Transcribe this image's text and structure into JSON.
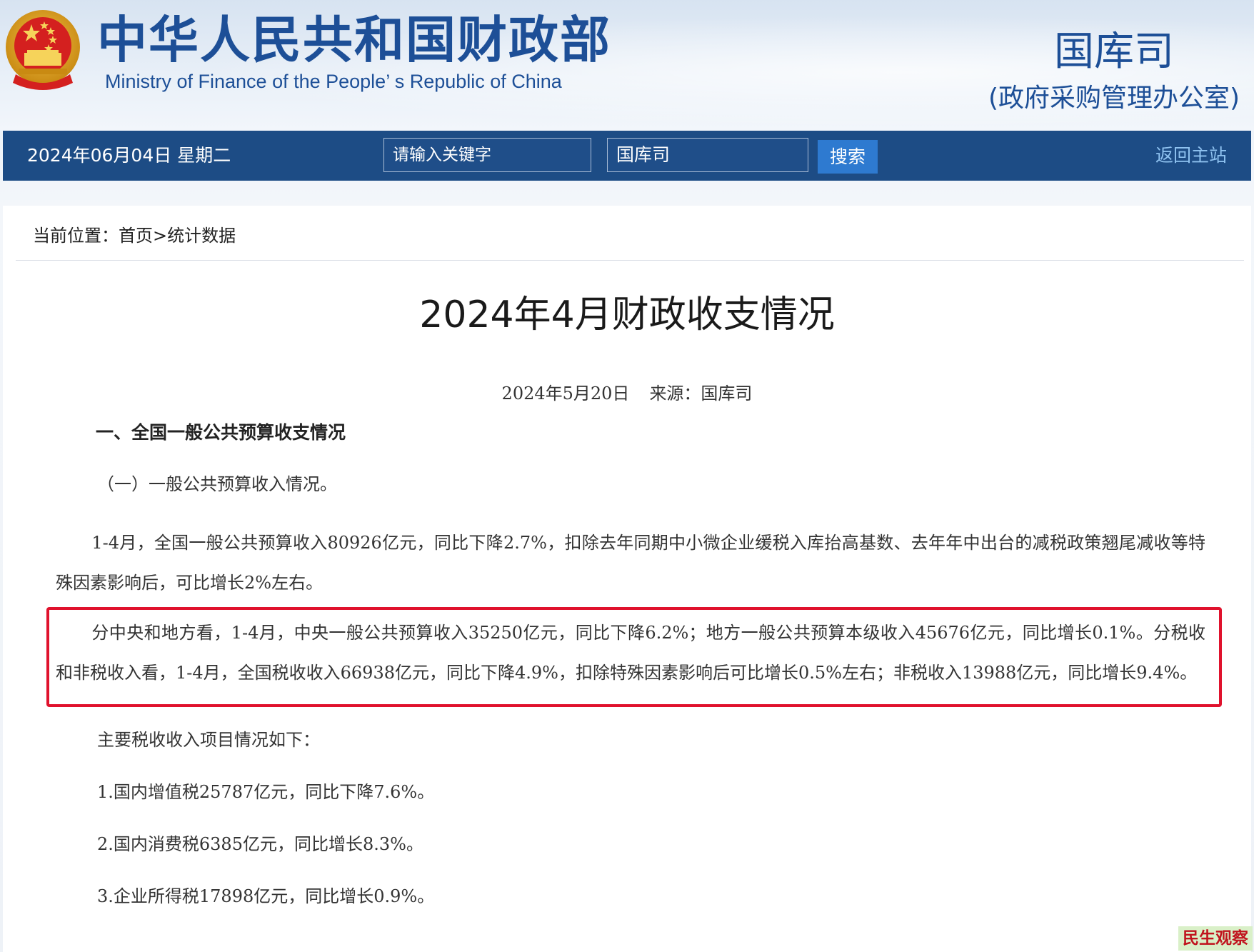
{
  "header": {
    "ministry_cn": "中华人民共和国财政部",
    "ministry_en": "Ministry of Finance of the People’ s Republic of China",
    "department": "国库司",
    "department_sub": "(政府采购管理办公室)"
  },
  "navbar": {
    "date": "2024年06月04日  星期二",
    "keyword_placeholder": "请输入关键字",
    "scope_value": "国库司",
    "search_label": "搜索",
    "home_link": "返回主站"
  },
  "breadcrumb": "当前位置：首页>统计数据",
  "article": {
    "title": "2024年4月财政收支情况",
    "date": "2024年5月20日",
    "source": "来源：国库司",
    "section_heading": "一、全国一般公共预算收支情况",
    "subsection": "（一）一般公共预算收入情况。",
    "paragraph_1": "1-4月，全国一般公共预算收入80926亿元，同比下降2.7%，扣除去年同期中小微企业缓税入库抬高基数、去年年中出台的减税政策翘尾减收等特殊因素影响后，可比增长2%左右。",
    "paragraph_2": "分中央和地方看，1-4月，中央一般公共预算收入35250亿元，同比下降6.2%；地方一般公共预算本级收入45676亿元，同比增长0.1%。分税收和非税收入看，1-4月，全国税收收入66938亿元，同比下降4.9%，扣除特殊因素影响后可比增长0.5%左右；非税收入13988亿元，同比增长9.4%。",
    "tax_intro": "主要税收收入项目情况如下：",
    "tax_items": [
      "1.国内增值税25787亿元，同比下降7.6%。",
      "2.国内消费税6385亿元，同比增长8.3%。",
      "3.企业所得税17898亿元，同比增长0.9%。"
    ]
  },
  "watermark": "民生观察",
  "colors": {
    "brand_blue": "#1d4f97",
    "navbar": "#1d4c85",
    "search_button": "#2e7ad0",
    "highlight_border": "#e0122d"
  }
}
